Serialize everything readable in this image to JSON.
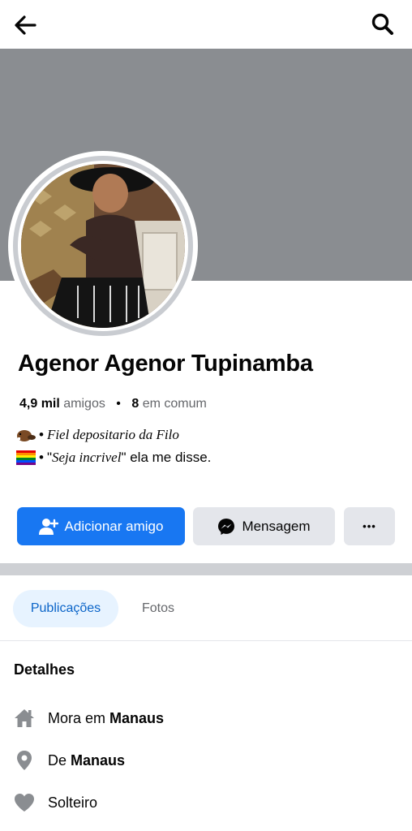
{
  "topbar": {
    "back_icon": "arrow-left-icon",
    "search_icon": "search-icon"
  },
  "profile": {
    "name": "Agenor Agenor Tupinamba",
    "friends_count": "4,9 mil",
    "friends_label": "amigos",
    "separator": "•",
    "mutual_count": "8",
    "mutual_label": "em comum"
  },
  "bio": {
    "line1_emoji": "beaver-emoji",
    "line1_bullet": "•",
    "line1_text": "Fiel depositario da Filo",
    "line2_emoji": "rainbow-flag-emoji",
    "line2_bullet": "•",
    "line2_quote_open": "\"",
    "line2_italic": "Seja incrivel",
    "line2_quote_close": "\"",
    "line2_text": " ela me disse."
  },
  "actions": {
    "add_friend_label": "Adicionar amigo",
    "message_label": "Mensagem",
    "more_label": "•••"
  },
  "tabs": [
    {
      "label": "Publicações",
      "active": true
    },
    {
      "label": "Fotos",
      "active": false
    }
  ],
  "details": {
    "title": "Detalhes",
    "items": [
      {
        "icon": "home-icon",
        "prefix": "Mora em",
        "value": "Manaus"
      },
      {
        "icon": "location-pin-icon",
        "prefix": "De",
        "value": "Manaus"
      },
      {
        "icon": "heart-icon",
        "prefix": "Solteiro",
        "value": ""
      }
    ]
  },
  "colors": {
    "primary": "#1877f2",
    "cover": "#8a8d91",
    "button_secondary": "#e4e6eb",
    "tab_active_bg": "#e7f3ff",
    "tab_active_text": "#0a64c8",
    "muted_text": "#65676b",
    "icon_gray": "#8a8d91"
  }
}
